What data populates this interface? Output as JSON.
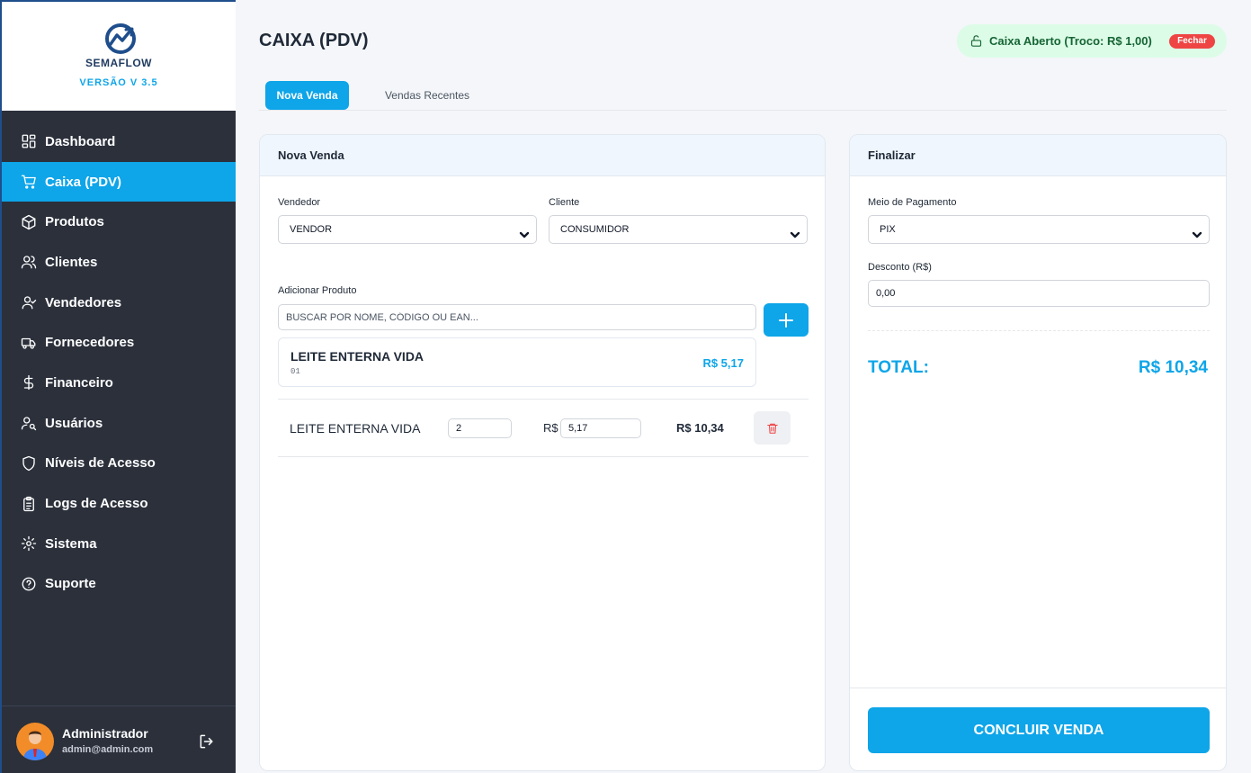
{
  "brand": {
    "name_prefix": "SEMA",
    "name_suffix": "FLOW",
    "version": "VERSÃO V 3.5"
  },
  "sidebar": {
    "items": [
      {
        "label": "Dashboard",
        "icon": "dashboard-icon"
      },
      {
        "label": "Caixa (PDV)",
        "icon": "cart-icon",
        "active": true
      },
      {
        "label": "Produtos",
        "icon": "box-icon"
      },
      {
        "label": "Clientes",
        "icon": "users-icon"
      },
      {
        "label": "Vendedores",
        "icon": "user-check-icon"
      },
      {
        "label": "Fornecedores",
        "icon": "truck-icon"
      },
      {
        "label": "Financeiro",
        "icon": "dollar-icon"
      },
      {
        "label": "Usuários",
        "icon": "user-key-icon"
      },
      {
        "label": "Níveis de Acesso",
        "icon": "shield-icon"
      },
      {
        "label": "Logs de Acesso",
        "icon": "clipboard-icon"
      },
      {
        "label": "Sistema",
        "icon": "gear-icon"
      },
      {
        "label": "Suporte",
        "icon": "help-icon"
      }
    ],
    "user": {
      "name": "Administrador",
      "email": "admin@admin.com"
    }
  },
  "header": {
    "title": "CAIXA (PDV)",
    "cash_status": "Caixa Aberto (Troco: R$ 1,00)",
    "close_label": "Fechar"
  },
  "tabs": [
    {
      "label": "Nova Venda",
      "active": true
    },
    {
      "label": "Vendas Recentes",
      "active": false
    }
  ],
  "sale": {
    "title": "Nova Venda",
    "seller_label": "Vendedor",
    "seller_value": "VENDOR",
    "client_label": "Cliente",
    "client_value": "CONSUMIDOR",
    "add_product_label": "Adicionar Produto",
    "search_placeholder": "BUSCAR POR NOME, CÓDIGO OU EAN...",
    "suggestion": {
      "name": "LEITE ENTERNA VIDA",
      "code": "01",
      "price": "R$ 5,17"
    },
    "items": [
      {
        "name": "LEITE ENTERNA VIDA",
        "quantity": "2",
        "currency": "R$",
        "unit_price": "5,17",
        "subtotal": "R$ 10,34"
      }
    ]
  },
  "finalize": {
    "title": "Finalizar",
    "payment_label": "Meio de Pagamento",
    "payment_value": "PIX",
    "discount_label": "Desconto (R$)",
    "discount_value": "0,00",
    "total_label": "TOTAL:",
    "total_value": "R$ 10,34",
    "conclude_label": "CONCLUIR VENDA"
  },
  "colors": {
    "accent": "#0ea5e9",
    "sidebar_bg": "#2b303b",
    "status_bg": "#dcfce7",
    "status_text": "#166534",
    "danger": "#ef4444"
  }
}
